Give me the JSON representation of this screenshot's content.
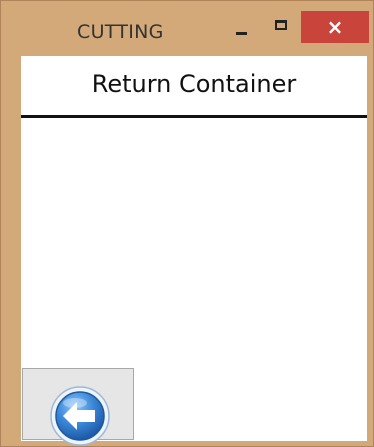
{
  "window": {
    "title": "CUTTING",
    "close_label": "×"
  },
  "header": {
    "title": "Return Container"
  },
  "icons": {
    "minimize": "minimize-icon",
    "maximize": "maximize-icon",
    "close": "close-icon",
    "back": "back-arrow-icon"
  },
  "colors": {
    "window_frame": "#d3a97a",
    "close_button": "#c9443b",
    "back_icon": "#3a86d6"
  }
}
